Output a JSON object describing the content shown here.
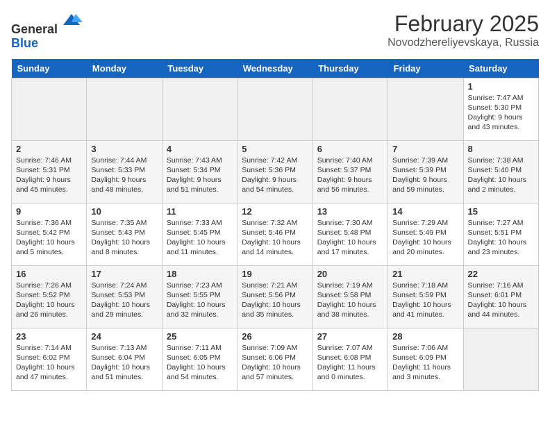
{
  "header": {
    "logo_line1": "General",
    "logo_line2": "Blue",
    "title": "February 2025",
    "subtitle": "Novodzhereliyevskaya, Russia"
  },
  "columns": [
    "Sunday",
    "Monday",
    "Tuesday",
    "Wednesday",
    "Thursday",
    "Friday",
    "Saturday"
  ],
  "weeks": [
    [
      {
        "day": "",
        "info": ""
      },
      {
        "day": "",
        "info": ""
      },
      {
        "day": "",
        "info": ""
      },
      {
        "day": "",
        "info": ""
      },
      {
        "day": "",
        "info": ""
      },
      {
        "day": "",
        "info": ""
      },
      {
        "day": "1",
        "info": "Sunrise: 7:47 AM\nSunset: 5:30 PM\nDaylight: 9 hours and 43 minutes."
      }
    ],
    [
      {
        "day": "2",
        "info": "Sunrise: 7:46 AM\nSunset: 5:31 PM\nDaylight: 9 hours and 45 minutes."
      },
      {
        "day": "3",
        "info": "Sunrise: 7:44 AM\nSunset: 5:33 PM\nDaylight: 9 hours and 48 minutes."
      },
      {
        "day": "4",
        "info": "Sunrise: 7:43 AM\nSunset: 5:34 PM\nDaylight: 9 hours and 51 minutes."
      },
      {
        "day": "5",
        "info": "Sunrise: 7:42 AM\nSunset: 5:36 PM\nDaylight: 9 hours and 54 minutes."
      },
      {
        "day": "6",
        "info": "Sunrise: 7:40 AM\nSunset: 5:37 PM\nDaylight: 9 hours and 56 minutes."
      },
      {
        "day": "7",
        "info": "Sunrise: 7:39 AM\nSunset: 5:39 PM\nDaylight: 9 hours and 59 minutes."
      },
      {
        "day": "8",
        "info": "Sunrise: 7:38 AM\nSunset: 5:40 PM\nDaylight: 10 hours and 2 minutes."
      }
    ],
    [
      {
        "day": "9",
        "info": "Sunrise: 7:36 AM\nSunset: 5:42 PM\nDaylight: 10 hours and 5 minutes."
      },
      {
        "day": "10",
        "info": "Sunrise: 7:35 AM\nSunset: 5:43 PM\nDaylight: 10 hours and 8 minutes."
      },
      {
        "day": "11",
        "info": "Sunrise: 7:33 AM\nSunset: 5:45 PM\nDaylight: 10 hours and 11 minutes."
      },
      {
        "day": "12",
        "info": "Sunrise: 7:32 AM\nSunset: 5:46 PM\nDaylight: 10 hours and 14 minutes."
      },
      {
        "day": "13",
        "info": "Sunrise: 7:30 AM\nSunset: 5:48 PM\nDaylight: 10 hours and 17 minutes."
      },
      {
        "day": "14",
        "info": "Sunrise: 7:29 AM\nSunset: 5:49 PM\nDaylight: 10 hours and 20 minutes."
      },
      {
        "day": "15",
        "info": "Sunrise: 7:27 AM\nSunset: 5:51 PM\nDaylight: 10 hours and 23 minutes."
      }
    ],
    [
      {
        "day": "16",
        "info": "Sunrise: 7:26 AM\nSunset: 5:52 PM\nDaylight: 10 hours and 26 minutes."
      },
      {
        "day": "17",
        "info": "Sunrise: 7:24 AM\nSunset: 5:53 PM\nDaylight: 10 hours and 29 minutes."
      },
      {
        "day": "18",
        "info": "Sunrise: 7:23 AM\nSunset: 5:55 PM\nDaylight: 10 hours and 32 minutes."
      },
      {
        "day": "19",
        "info": "Sunrise: 7:21 AM\nSunset: 5:56 PM\nDaylight: 10 hours and 35 minutes."
      },
      {
        "day": "20",
        "info": "Sunrise: 7:19 AM\nSunset: 5:58 PM\nDaylight: 10 hours and 38 minutes."
      },
      {
        "day": "21",
        "info": "Sunrise: 7:18 AM\nSunset: 5:59 PM\nDaylight: 10 hours and 41 minutes."
      },
      {
        "day": "22",
        "info": "Sunrise: 7:16 AM\nSunset: 6:01 PM\nDaylight: 10 hours and 44 minutes."
      }
    ],
    [
      {
        "day": "23",
        "info": "Sunrise: 7:14 AM\nSunset: 6:02 PM\nDaylight: 10 hours and 47 minutes."
      },
      {
        "day": "24",
        "info": "Sunrise: 7:13 AM\nSunset: 6:04 PM\nDaylight: 10 hours and 51 minutes."
      },
      {
        "day": "25",
        "info": "Sunrise: 7:11 AM\nSunset: 6:05 PM\nDaylight: 10 hours and 54 minutes."
      },
      {
        "day": "26",
        "info": "Sunrise: 7:09 AM\nSunset: 6:06 PM\nDaylight: 10 hours and 57 minutes."
      },
      {
        "day": "27",
        "info": "Sunrise: 7:07 AM\nSunset: 6:08 PM\nDaylight: 11 hours and 0 minutes."
      },
      {
        "day": "28",
        "info": "Sunrise: 7:06 AM\nSunset: 6:09 PM\nDaylight: 11 hours and 3 minutes."
      },
      {
        "day": "",
        "info": ""
      }
    ]
  ]
}
